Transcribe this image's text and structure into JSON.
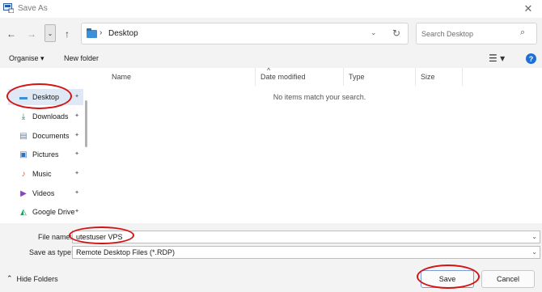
{
  "window": {
    "title": "Save As",
    "close_glyph": "✕"
  },
  "navigation": {
    "back_glyph": "←",
    "forward_glyph": "→",
    "recent_glyph": "⌄",
    "up_glyph": "↑",
    "address": {
      "separator": "›",
      "crumb": "Desktop",
      "dropdown_glyph": "⌄",
      "refresh_glyph": "↻"
    },
    "search": {
      "placeholder": "Search Desktop",
      "icon_glyph": "⌕"
    }
  },
  "command_bar": {
    "organise_label": "Organise ▾",
    "new_folder_label": "New folder",
    "view_glyph": "☰ ▾",
    "help_glyph": "?"
  },
  "sidebar": {
    "items": [
      {
        "label": "Desktop",
        "icon": "desktop-icon",
        "glyph": "▬",
        "color": "#3d8fd6"
      },
      {
        "label": "Downloads",
        "icon": "download-icon",
        "glyph": "⤓",
        "color": "#1c8a4a"
      },
      {
        "label": "Documents",
        "icon": "document-icon",
        "glyph": "▤",
        "color": "#6a7f9a"
      },
      {
        "label": "Pictures",
        "icon": "picture-icon",
        "glyph": "▣",
        "color": "#2a73c5"
      },
      {
        "label": "Music",
        "icon": "music-icon",
        "glyph": "♪",
        "color": "#e0603a"
      },
      {
        "label": "Videos",
        "icon": "video-icon",
        "glyph": "▶",
        "color": "#8b3fc6"
      },
      {
        "label": "Google Drive",
        "icon": "google-drive-icon",
        "glyph": "◭",
        "color": "#1aa260"
      }
    ],
    "pin_glyph": "📌"
  },
  "file_list": {
    "columns": [
      "Name",
      "Date modified",
      "Type",
      "Size"
    ],
    "sort_glyph": "^",
    "empty_message": "No items match your search."
  },
  "form": {
    "file_name_label": "File name:",
    "file_name_value": "utestuser VPS",
    "save_as_type_label": "Save as type:",
    "save_as_type_value": "Remote Desktop Files (*.RDP)",
    "dropdown_glyph": "⌄"
  },
  "footer": {
    "hide_folders_glyph": "⌃",
    "hide_folders_label": "Hide Folders",
    "save_label": "Save",
    "cancel_label": "Cancel"
  },
  "colors": {
    "annotation": "#d21414",
    "accent": "#1f6fd6",
    "selection": "#dfe8f5"
  }
}
